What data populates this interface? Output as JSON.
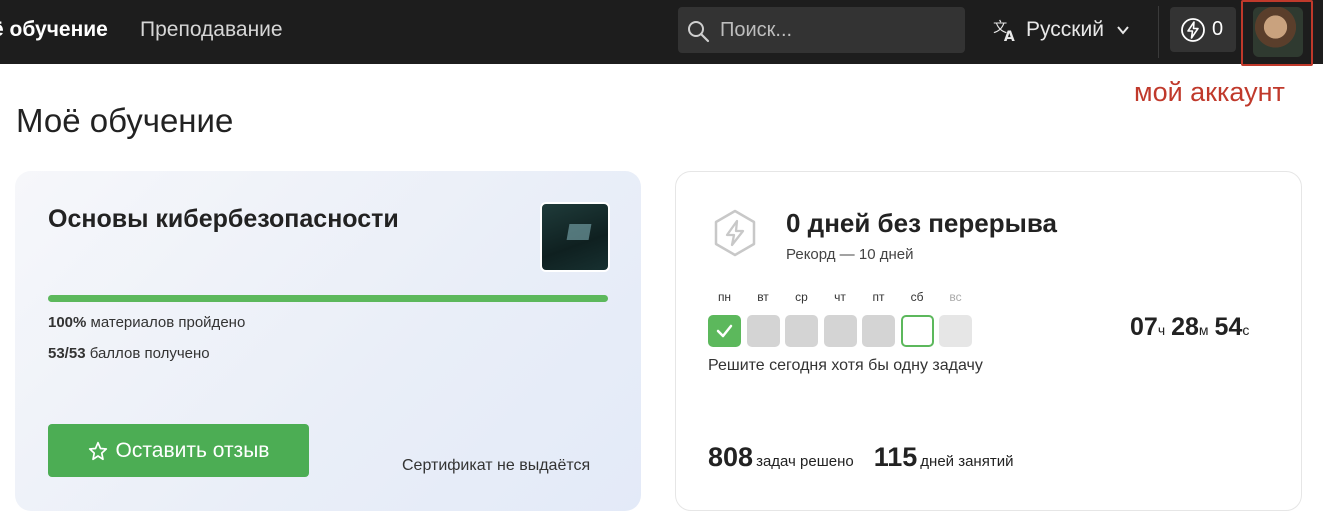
{
  "nav": {
    "my_learning": "ё обучение",
    "teaching": "Преподавание"
  },
  "search": {
    "placeholder": "Поиск..."
  },
  "language": {
    "label": "Русский"
  },
  "energy": {
    "count": "0"
  },
  "account": {
    "annotation": "мой аккаунт"
  },
  "page": {
    "title": "Моё обучение"
  },
  "course": {
    "title": "Основы кибербезопасности",
    "progress_fraction": 1.0,
    "materials_pct": "100%",
    "materials_label": " материалов пройдено",
    "points": "53/53",
    "points_label": " баллов получено",
    "review_button": "Оставить отзыв",
    "certificate": "Сертификат не выдаётся"
  },
  "streak": {
    "title": "0 дней без перерыва",
    "record": "Рекорд — 10 дней",
    "days": [
      {
        "label": "пн",
        "state": "done"
      },
      {
        "label": "вт",
        "state": "missed"
      },
      {
        "label": "ср",
        "state": "missed"
      },
      {
        "label": "чт",
        "state": "missed"
      },
      {
        "label": "пт",
        "state": "missed"
      },
      {
        "label": "сб",
        "state": "today"
      },
      {
        "label": "вс",
        "state": "future"
      }
    ],
    "hint": "Решите сегодня хотя бы одну задачу",
    "timer": {
      "hours": "07",
      "h_unit": "ч",
      "minutes": "28",
      "m_unit": "м",
      "seconds": "54",
      "s_unit": "с"
    },
    "tasks_solved": "808",
    "tasks_label": "задач решено",
    "days_active": "115",
    "days_label": "дней занятий"
  },
  "colors": {
    "accent_green": "#4cad54",
    "topbar": "#1d1d1d",
    "annotation_red": "#c0392b"
  }
}
